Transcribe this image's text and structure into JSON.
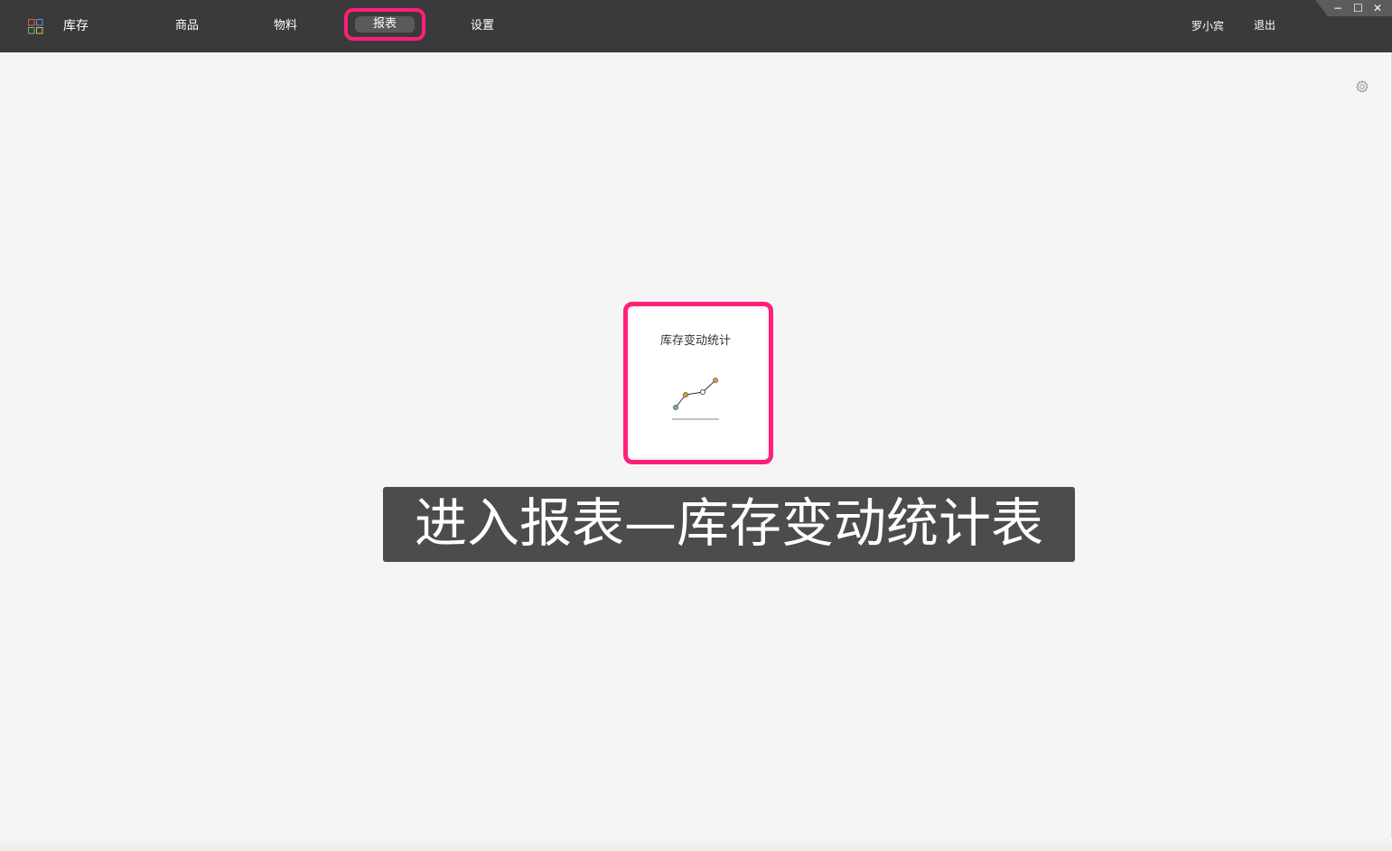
{
  "header": {
    "brand": "库存",
    "nav": [
      {
        "label": "商品"
      },
      {
        "label": "物料"
      },
      {
        "label": "报表",
        "active": true
      },
      {
        "label": "设置"
      }
    ],
    "user_name": "罗小宾",
    "logout_label": "退出"
  },
  "window_controls": {
    "minimize": "−",
    "maximize": "☐",
    "close": "✕"
  },
  "main": {
    "report_card": {
      "title": "库存变动统计",
      "icon": "line-chart-icon"
    },
    "settings_icon": "gear-icon"
  },
  "caption": "进入报表—库存变动统计表",
  "colors": {
    "topbar": "#3a3a3a",
    "highlight": "#ff1f7a",
    "background": "#f5f5f5",
    "caption_bg": "#4c4c4c"
  }
}
